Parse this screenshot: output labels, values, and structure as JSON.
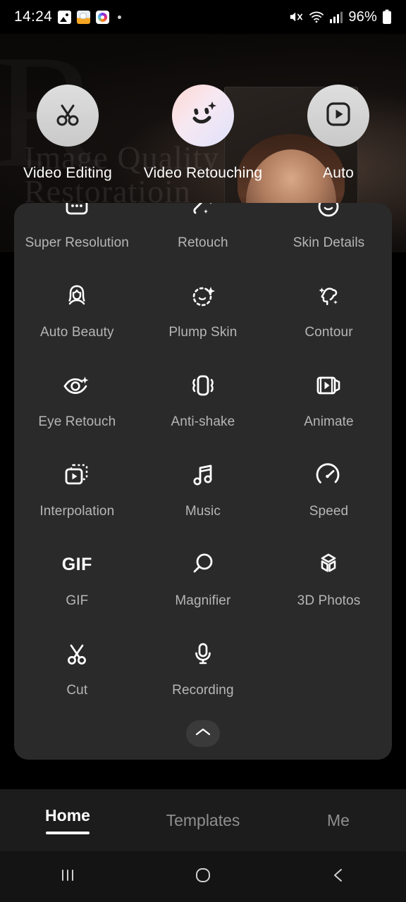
{
  "statusbar": {
    "time": "14:24",
    "icons": [
      "gallery-icon",
      "sticker-icon",
      "camera-icon",
      "dot-indicator"
    ],
    "mute_icon": "mute-icon",
    "wifi_icon": "wifi-icon",
    "signal_icon": "signal-icon",
    "battery_text": "96%",
    "battery_icon": "battery-icon"
  },
  "hero": {
    "watermark_line1": "Image Quality",
    "watermark_line2": "Restoratioin",
    "bigletter": "R"
  },
  "quick_actions": [
    {
      "label": "Video Editing",
      "icon": "scissors-icon",
      "style": "grey"
    },
    {
      "label": "Video Retouching",
      "icon": "smiley-sparkle-icon",
      "style": "gradient"
    },
    {
      "label": "Auto",
      "icon": "play-square-icon",
      "style": "grey"
    }
  ],
  "tools": [
    {
      "label": "Super Resolution",
      "icon": "frame-dots-icon"
    },
    {
      "label": "Retouch",
      "icon": "magic-wand-icon"
    },
    {
      "label": "Skin Details",
      "icon": "smile-face-icon"
    },
    {
      "label": "Auto Beauty",
      "icon": "woman-avatar-icon"
    },
    {
      "label": "Plump Skin",
      "icon": "dashed-face-sparkle-icon"
    },
    {
      "label": "Contour",
      "icon": "face-profile-sparkle-icon"
    },
    {
      "label": "Eye Retouch",
      "icon": "eye-sparkle-icon"
    },
    {
      "label": "Anti-shake",
      "icon": "phone-vibrate-icon"
    },
    {
      "label": "Animate",
      "icon": "film-play-icon"
    },
    {
      "label": "Interpolation",
      "icon": "frames-play-dashed-icon"
    },
    {
      "label": "Music",
      "icon": "music-note-icon"
    },
    {
      "label": "Speed",
      "icon": "speedometer-icon"
    },
    {
      "label": "GIF",
      "icon": "gif-text-icon"
    },
    {
      "label": "Magnifier",
      "icon": "magnifier-icon"
    },
    {
      "label": "3D Photos",
      "icon": "cube-3d-icon"
    },
    {
      "label": "Cut",
      "icon": "scissors-icon"
    },
    {
      "label": "Recording",
      "icon": "microphone-icon"
    }
  ],
  "panel": {
    "collapse_icon": "chevron-up-icon"
  },
  "tabs": [
    {
      "label": "Home",
      "active": true
    },
    {
      "label": "Templates",
      "active": false
    },
    {
      "label": "Me",
      "active": false
    }
  ],
  "navbar": {
    "recents_icon": "recents-icon",
    "home_icon": "home-circle-icon",
    "back_icon": "back-chevron-icon"
  },
  "colors": {
    "panel_bg": "#2a2a2a",
    "tabbar_bg": "#1c1c1c",
    "label_grey": "#b6b6b6",
    "accent_white": "#ffffff"
  }
}
